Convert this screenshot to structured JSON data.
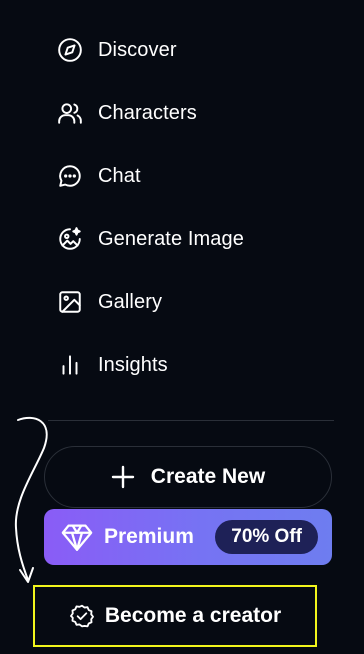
{
  "nav": {
    "items": [
      {
        "label": "Discover",
        "icon": "compass-icon"
      },
      {
        "label": "Characters",
        "icon": "users-icon"
      },
      {
        "label": "Chat",
        "icon": "chat-bubble-icon"
      },
      {
        "label": "Generate Image",
        "icon": "image-sparkle-icon"
      },
      {
        "label": "Gallery",
        "icon": "gallery-icon"
      },
      {
        "label": "Insights",
        "icon": "bar-chart-icon"
      }
    ]
  },
  "actions": {
    "create_new": "Create New",
    "premium": "Premium",
    "premium_badge": "70% Off",
    "become_creator": "Become a creator"
  },
  "colors": {
    "background": "#060a12",
    "premium_gradient_start": "#8a5cf6",
    "premium_gradient_end": "#6e7df0",
    "badge_bg": "#1e2157",
    "highlight_border": "#f2f51c"
  }
}
